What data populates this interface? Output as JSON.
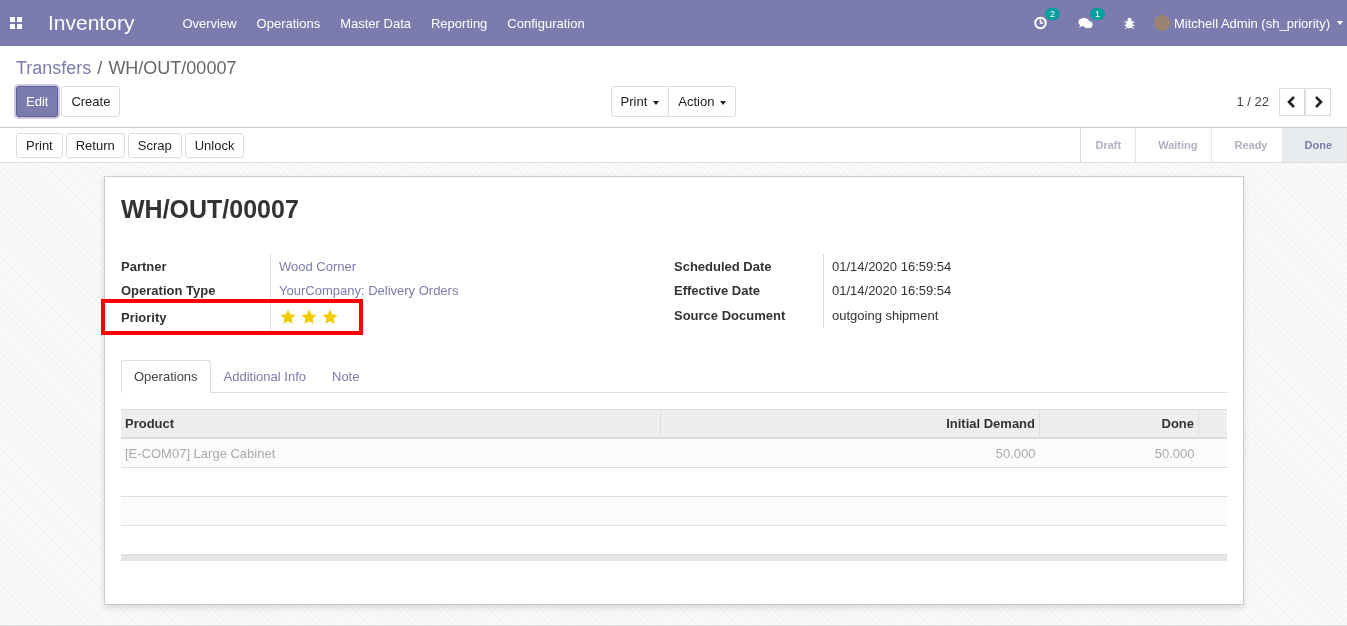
{
  "navbar": {
    "app_title": "Inventory",
    "menu": [
      "Overview",
      "Operations",
      "Master Data",
      "Reporting",
      "Configuration"
    ],
    "activity_count": "2",
    "message_count": "1",
    "user": "Mitchell Admin (sh_priority)"
  },
  "breadcrumb": {
    "parent": "Transfers",
    "separator": "/",
    "current": "WH/OUT/00007"
  },
  "control_buttons": [
    "Edit",
    "Create"
  ],
  "dropdowns": [
    "Print",
    "Action"
  ],
  "pager": "1 / 22",
  "action_buttons": [
    "Print",
    "Return",
    "Scrap",
    "Unlock"
  ],
  "stages": [
    {
      "label": "Draft",
      "selected": false
    },
    {
      "label": "Waiting",
      "selected": false
    },
    {
      "label": "Ready",
      "selected": false
    },
    {
      "label": "Done",
      "selected": true
    }
  ],
  "record_title": "WH/OUT/00007",
  "left_fields": [
    {
      "label": "Partner",
      "kind": "link",
      "value": "Wood Corner"
    },
    {
      "label": "Operation Type",
      "kind": "link",
      "value": "YourCompany: Delivery Orders"
    },
    {
      "label": "Priority",
      "kind": "stars",
      "stars": 3,
      "highlighted": true
    }
  ],
  "right_fields": [
    {
      "label": "Scheduled Date",
      "value": "01/14/2020 16:59:54"
    },
    {
      "label": "Effective Date",
      "value": "01/14/2020 16:59:54"
    },
    {
      "label": "Source Document",
      "value": "outgoing shipment"
    }
  ],
  "tabs": [
    {
      "label": "Operations",
      "selected": true
    },
    {
      "label": "Additional Info",
      "selected": false
    },
    {
      "label": "Note",
      "selected": false
    }
  ],
  "table": {
    "columns": [
      "Product",
      "Initial Demand",
      "Done"
    ],
    "rows": [
      {
        "product": "[E-COM07] Large Cabinet",
        "initial_demand": "50.000",
        "done": "50.000"
      }
    ]
  }
}
